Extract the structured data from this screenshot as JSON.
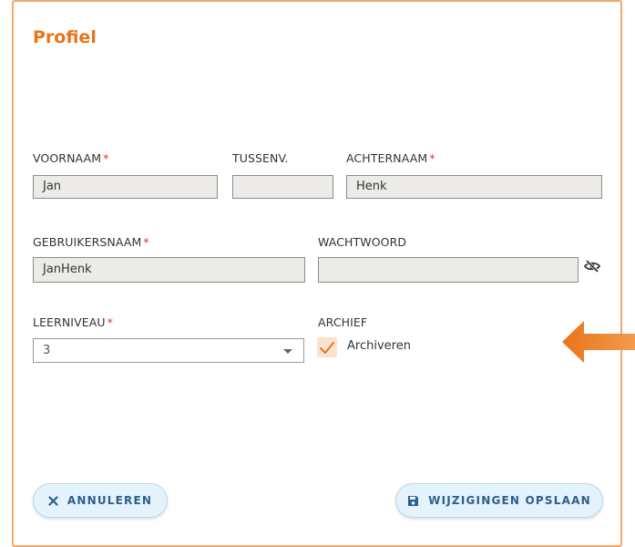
{
  "title": "Profiel",
  "fields": {
    "voornaam": {
      "label": "VOORNAAM",
      "value": "Jan",
      "required": "*"
    },
    "tussenv": {
      "label": "TUSSENV.",
      "value": ""
    },
    "achternaam": {
      "label": "ACHTERNAAM",
      "value": "Henk",
      "required": "*"
    },
    "gebruikersnaam": {
      "label": "GEBRUIKERSNAAM",
      "value": "JanHenk",
      "required": "*"
    },
    "wachtwoord": {
      "label": "WACHTWOORD",
      "value": ""
    },
    "leerniveau": {
      "label": "LEERNIVEAU",
      "value": "3",
      "required": "*"
    },
    "archief": {
      "label": "ARCHIEF",
      "checkbox_label": "Archiveren",
      "checked": true
    }
  },
  "buttons": {
    "cancel": "ANNULEREN",
    "save": "WIJZIGINGEN OPSLAAN"
  },
  "icons": {
    "password_toggle": "eye-slash-icon",
    "cancel": "close-icon",
    "save": "floppy-disk-icon",
    "pointer": "arrow-left-icon"
  },
  "colors": {
    "accent": "#e8741c",
    "required": "#e0312a",
    "button_text": "#2b5f8e",
    "button_bg": "#e4f2fb"
  }
}
